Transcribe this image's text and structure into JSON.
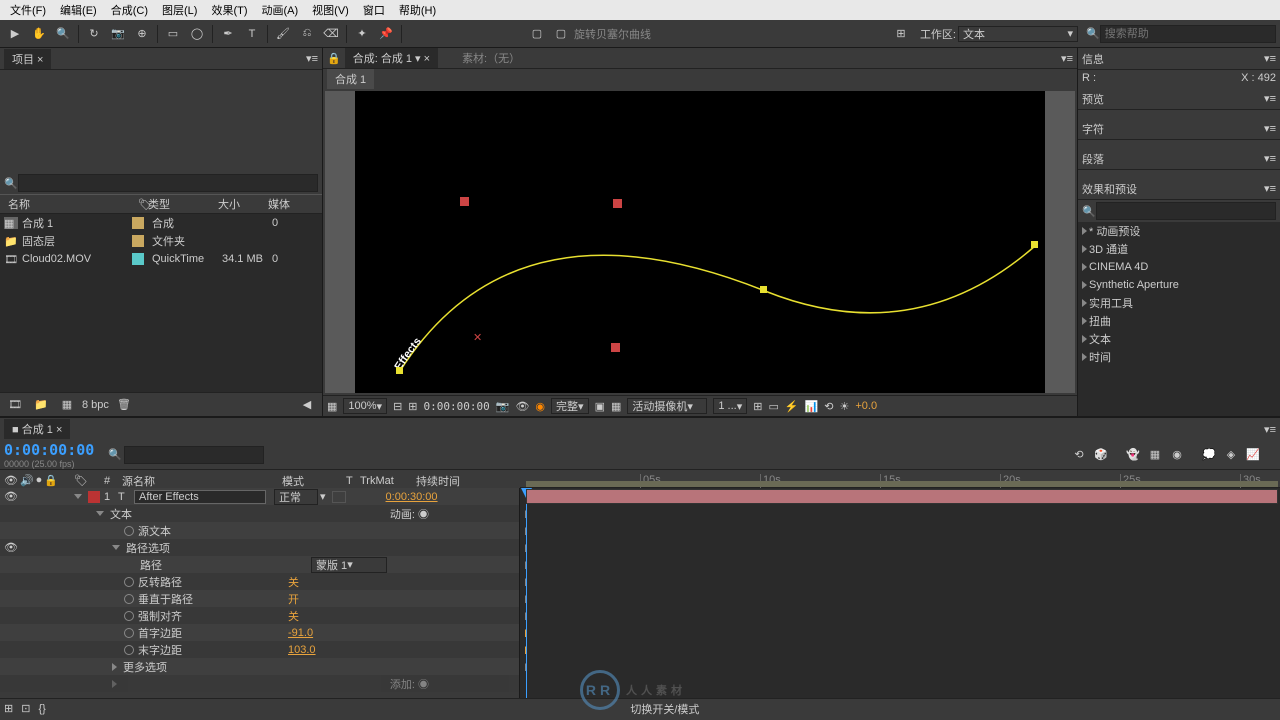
{
  "menu": [
    "文件(F)",
    "编辑(E)",
    "合成(C)",
    "图层(L)",
    "效果(T)",
    "动画(A)",
    "视图(V)",
    "窗口",
    "帮助(H)"
  ],
  "toolbar_label": "旋转贝塞尔曲线",
  "workspace_label": "工作区:",
  "workspace_value": "文本",
  "search_help_placeholder": "搜索帮助",
  "project": {
    "tab": "项目",
    "search_placeholder": "",
    "columns": {
      "name": "名称",
      "type": "类型",
      "size": "大小",
      "media": "媒体"
    },
    "items": [
      {
        "name": "合成 1",
        "type": "合成",
        "size": "",
        "icon_color": "#c9a860"
      },
      {
        "name": "固态层",
        "type": "文件夹",
        "size": "",
        "icon_color": "#c9a860"
      },
      {
        "name": "Cloud02.MOV",
        "type": "QuickTime",
        "size": "34.1 MB",
        "icon_color": "#5ac9c9"
      }
    ],
    "bpc": "8 bpc"
  },
  "composition": {
    "lock_label": "合成: 合成 1",
    "material_label": "素材:（无）",
    "tab": "合成 1",
    "text_on_path": "Effects",
    "zoom": "100%",
    "time": "0:00:00:00",
    "resolution": "完整",
    "camera": "活动摄像机",
    "view_count": "1 ...",
    "exposure": "+0.0"
  },
  "info": {
    "panel": "信息",
    "r_label": "R :",
    "x_label": "X : 492"
  },
  "preview_panel": "预览",
  "char_panel": "字符",
  "para_panel": "段落",
  "effects_panel": {
    "title": "效果和预设",
    "search": "",
    "items": [
      "* 动画预设",
      "3D 通道",
      "CINEMA 4D",
      "Synthetic Aperture",
      "实用工具",
      "扭曲",
      "文本",
      "时间"
    ]
  },
  "timeline": {
    "tab": "合成 1",
    "timecode": "0:00:00:00",
    "fps": "00000 (25.00 fps)",
    "columns": {
      "source": "源名称",
      "mode": "模式",
      "trkmat": "TrkMat",
      "duration": "持续时间"
    },
    "ruler": [
      "05s",
      "10s",
      "15s",
      "20s",
      "25s",
      "30s"
    ],
    "layer": {
      "index": "1",
      "name": "After Effects",
      "mode": "正常",
      "duration": "0:00:30:00"
    },
    "properties": {
      "text_group": "文本",
      "animate": "动画:",
      "source_text": "源文本",
      "path_options": "路径选项",
      "path": "路径",
      "path_value": "蒙版 1",
      "reverse_path": "反转路径",
      "reverse_val": "关",
      "perpendicular": "垂直于路径",
      "perpendicular_val": "开",
      "force_align": "强制对齐",
      "force_align_val": "关",
      "first_margin": "首字边距",
      "first_margin_val": "-91.0",
      "last_margin": "末字边距",
      "last_margin_val": "103.0",
      "more_options": "更多选项",
      "add_label": "添加:"
    },
    "footer": "切换开关/模式"
  },
  "watermark": "人人素材"
}
